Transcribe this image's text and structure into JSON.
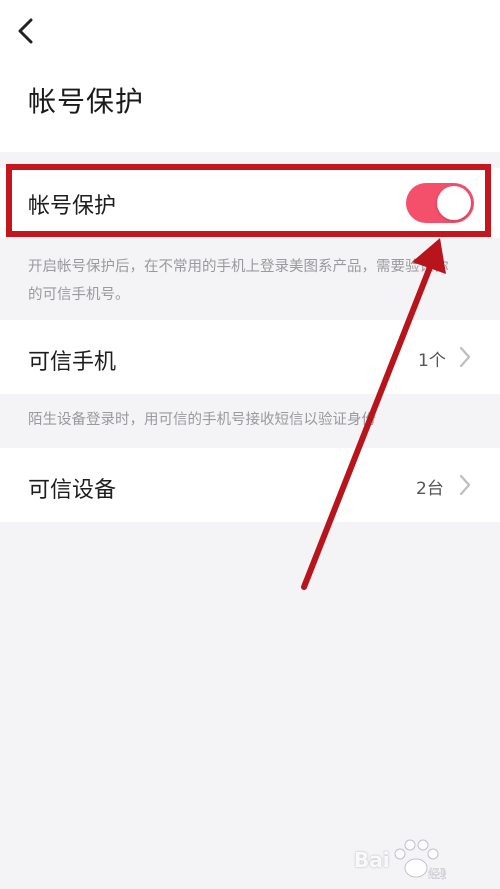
{
  "header": {
    "title": "帐号保护"
  },
  "account_protection": {
    "label": "帐号保护",
    "enabled": true,
    "hint_line1": "开启帐号保护后，在不常用的手机上登录美图系产品，需要验证你",
    "hint_line2": "的可信手机号。"
  },
  "trusted_phone": {
    "label": "可信手机",
    "count": "1个",
    "hint": "陌生设备登录时，用可信的手机号接收短信以验证身份"
  },
  "trusted_device": {
    "label": "可信设备",
    "count": "2台"
  },
  "watermark": {
    "text": "Bai",
    "paw_text": "经验"
  },
  "colors": {
    "toggle_on": "#f44f6b",
    "annotation_red": "#c4161c",
    "background": "#f4f4f6"
  },
  "icons": {
    "back": "chevron-left-icon",
    "row_arrow": "chevron-right-icon"
  }
}
